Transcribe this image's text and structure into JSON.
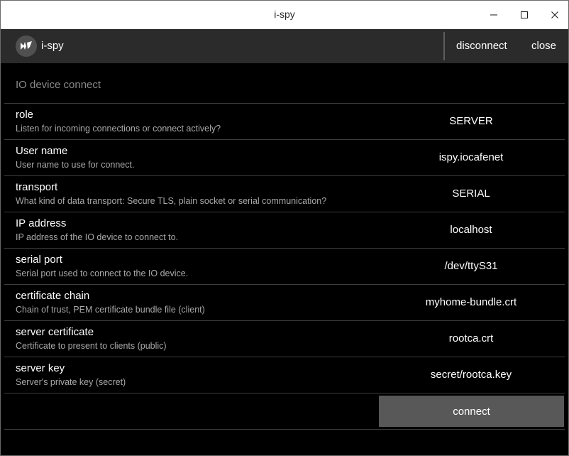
{
  "window": {
    "title": "i-spy"
  },
  "appbar": {
    "name": "i-spy",
    "logo_icon": "kivy-logo-icon",
    "disconnect_label": "disconnect",
    "close_label": "close"
  },
  "section": {
    "title": "IO device connect"
  },
  "settings": [
    {
      "label": "role",
      "description": "Listen for incoming connections or connect actively?",
      "value": "SERVER"
    },
    {
      "label": "User name",
      "description": "User name to use for connect.",
      "value": "ispy.iocafenet"
    },
    {
      "label": "transport",
      "description": "What kind of data transport: Secure TLS, plain socket or serial communication?",
      "value": "SERIAL"
    },
    {
      "label": "IP address",
      "description": "IP address of the IO device to connect to.",
      "value": "localhost"
    },
    {
      "label": "serial port",
      "description": "Serial port used to connect to the IO device.",
      "value": "/dev/ttyS31"
    },
    {
      "label": "certificate chain",
      "description": "Chain of trust, PEM certificate bundle file (client)",
      "value": "myhome-bundle.crt"
    },
    {
      "label": "server certificate",
      "description": "Certificate to present to clients (public)",
      "value": "rootca.crt"
    },
    {
      "label": "server key",
      "description": "Server's private key (secret)",
      "value": "secret/rootca.key"
    }
  ],
  "footer": {
    "connect_label": "connect"
  },
  "colors": {
    "background": "#000000",
    "appbar": "#2b2b2b",
    "button": "#585858",
    "divider": "#3c3c3c",
    "description_text": "#a9a9a9"
  }
}
